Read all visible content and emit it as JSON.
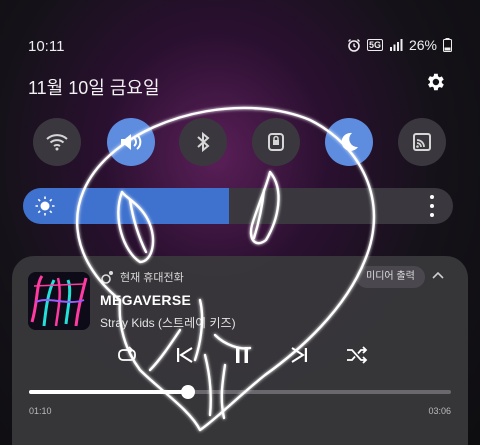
{
  "status_bar": {
    "time": "10:11",
    "network": "5G",
    "battery": "26%"
  },
  "header": {
    "date": "11월 10일 금요일"
  },
  "quick_settings": {
    "tiles": [
      {
        "icon": "wifi-icon",
        "active": false
      },
      {
        "icon": "sound-icon",
        "active": true
      },
      {
        "icon": "bluetooth-icon",
        "active": false
      },
      {
        "icon": "rotation-lock-icon",
        "active": false
      },
      {
        "icon": "dark-mode-icon",
        "active": true
      },
      {
        "icon": "cast-icon",
        "active": false
      }
    ],
    "brightness_level": 0.48
  },
  "media": {
    "device_label": "현재 휴대전화",
    "output_button": "미디어 출력",
    "title": "MEGAVERSE",
    "artist": "Stray Kids (스트레이 키즈)",
    "elapsed": "01:10",
    "total": "03:06",
    "progress": 0.376
  },
  "colors": {
    "accent": "#5e8de0",
    "brightness_fill": "#3f72cf",
    "tile_off": "#3a383e",
    "card": "#3a383c"
  }
}
